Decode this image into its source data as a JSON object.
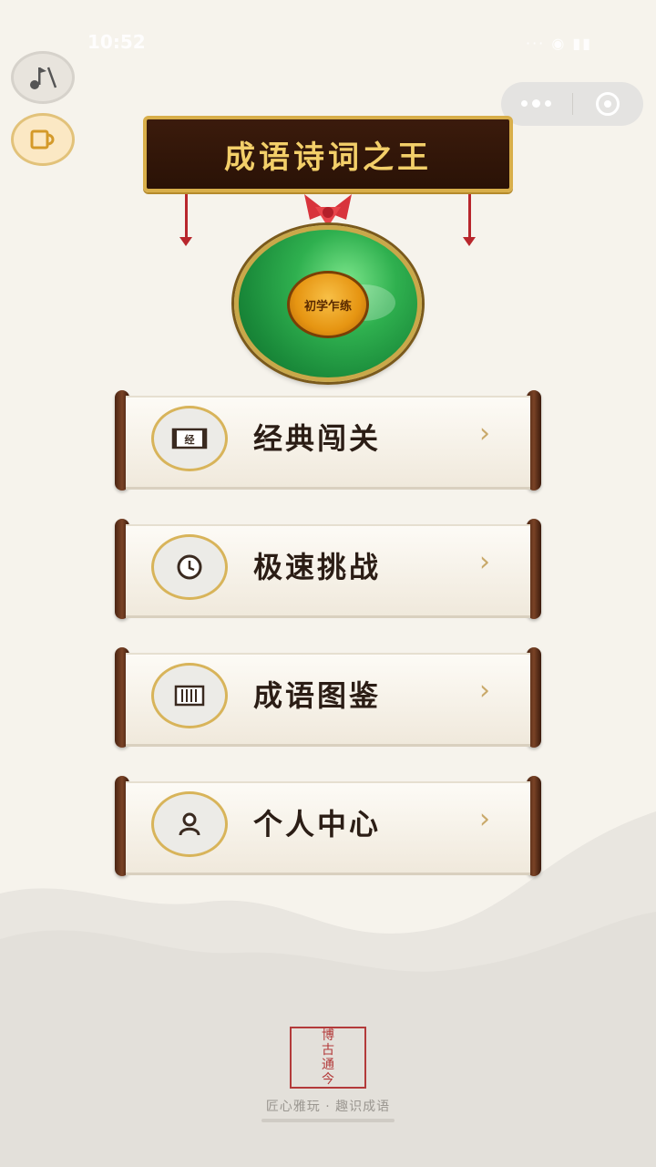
{
  "status_bar": {
    "time": "10:52",
    "right_icons": "··· ◉ ▮▮"
  },
  "left_buttons": {
    "music_icon": "music-note-icon",
    "cup_icon": "cup-icon"
  },
  "mini_program_capsule": {
    "more_icon": "more-dots-icon",
    "close_icon": "close-target-icon"
  },
  "header": {
    "title": "成语诗词之王"
  },
  "medal": {
    "rank": "初学乍练"
  },
  "menu": {
    "items": [
      {
        "label": "经典闯关",
        "icon": "scroll-book-icon",
        "icon_text": "经",
        "chevron": "›"
      },
      {
        "label": "极速挑战",
        "icon": "clock-icon",
        "chevron": "›"
      },
      {
        "label": "成语图鉴",
        "icon": "book-icon",
        "chevron": "›"
      },
      {
        "label": "个人中心",
        "icon": "person-icon",
        "chevron": "›"
      }
    ]
  },
  "footer": {
    "seal_text": "博古通今",
    "slogan": "匠心雅玩 · 趣识成语"
  },
  "colors": {
    "background": "#f6f3ec",
    "plaque": "#2a1206",
    "gold": "#d8ae4a",
    "jade": "#2fb04f",
    "seal_red": "#b33a3a"
  }
}
